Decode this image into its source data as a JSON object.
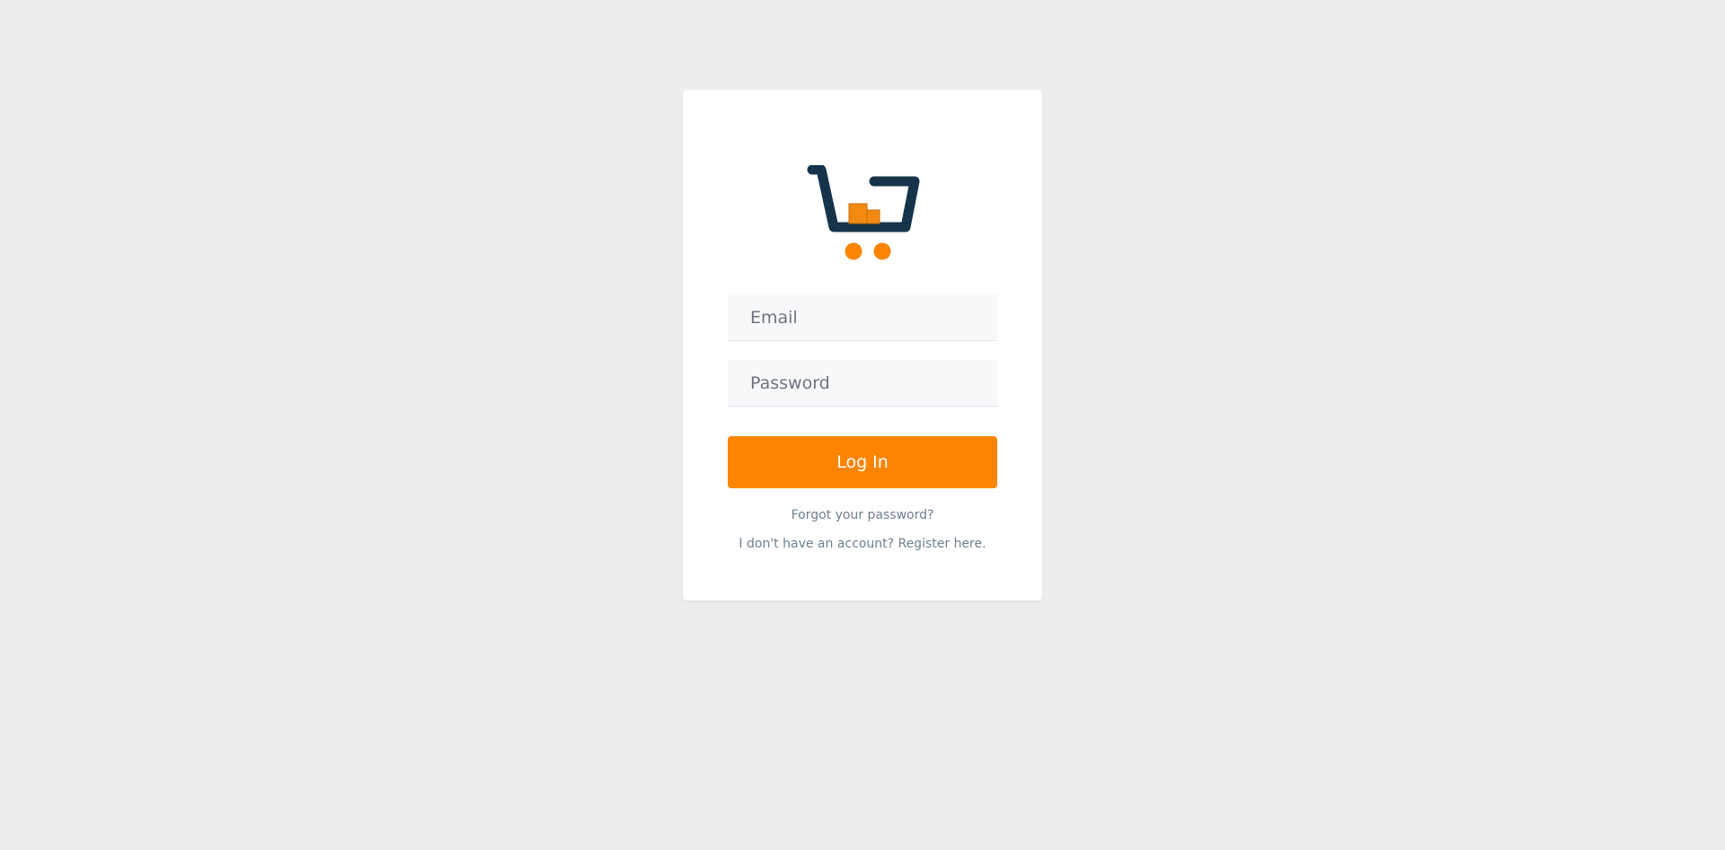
{
  "logo": {
    "icon": "shopping-cart-icon",
    "colors": {
      "frame": "#15344a",
      "accent": "#fb8500"
    }
  },
  "form": {
    "email_placeholder": "Email",
    "password_placeholder": "Password",
    "submit_label": "Log In"
  },
  "links": {
    "forgot_password": "Forgot your password?",
    "register": "I don't have an account? Register here."
  },
  "colors": {
    "background": "#ededed",
    "card": "#ffffff",
    "button": "#fb8500",
    "link_text": "#6d7f8f"
  }
}
